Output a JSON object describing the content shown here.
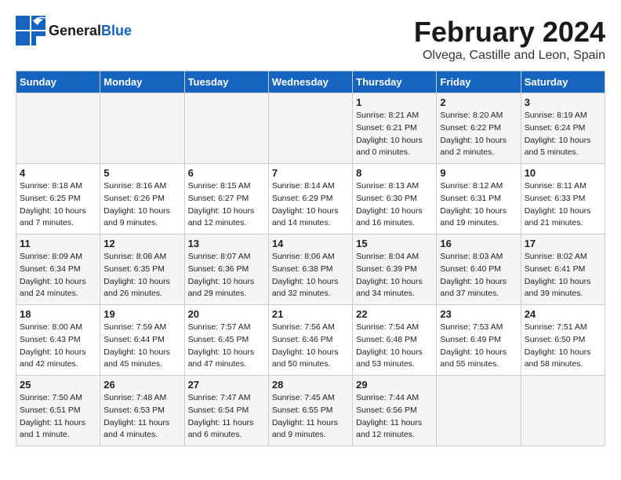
{
  "header": {
    "logo_general": "General",
    "logo_blue": "Blue",
    "month_year": "February 2024",
    "location": "Olvega, Castille and Leon, Spain"
  },
  "days_of_week": [
    "Sunday",
    "Monday",
    "Tuesday",
    "Wednesday",
    "Thursday",
    "Friday",
    "Saturday"
  ],
  "weeks": [
    [
      {
        "day": "",
        "info": ""
      },
      {
        "day": "",
        "info": ""
      },
      {
        "day": "",
        "info": ""
      },
      {
        "day": "",
        "info": ""
      },
      {
        "day": "1",
        "info": "Sunrise: 8:21 AM\nSunset: 6:21 PM\nDaylight: 10 hours\nand 0 minutes."
      },
      {
        "day": "2",
        "info": "Sunrise: 8:20 AM\nSunset: 6:22 PM\nDaylight: 10 hours\nand 2 minutes."
      },
      {
        "day": "3",
        "info": "Sunrise: 8:19 AM\nSunset: 6:24 PM\nDaylight: 10 hours\nand 5 minutes."
      }
    ],
    [
      {
        "day": "4",
        "info": "Sunrise: 8:18 AM\nSunset: 6:25 PM\nDaylight: 10 hours\nand 7 minutes."
      },
      {
        "day": "5",
        "info": "Sunrise: 8:16 AM\nSunset: 6:26 PM\nDaylight: 10 hours\nand 9 minutes."
      },
      {
        "day": "6",
        "info": "Sunrise: 8:15 AM\nSunset: 6:27 PM\nDaylight: 10 hours\nand 12 minutes."
      },
      {
        "day": "7",
        "info": "Sunrise: 8:14 AM\nSunset: 6:29 PM\nDaylight: 10 hours\nand 14 minutes."
      },
      {
        "day": "8",
        "info": "Sunrise: 8:13 AM\nSunset: 6:30 PM\nDaylight: 10 hours\nand 16 minutes."
      },
      {
        "day": "9",
        "info": "Sunrise: 8:12 AM\nSunset: 6:31 PM\nDaylight: 10 hours\nand 19 minutes."
      },
      {
        "day": "10",
        "info": "Sunrise: 8:11 AM\nSunset: 6:33 PM\nDaylight: 10 hours\nand 21 minutes."
      }
    ],
    [
      {
        "day": "11",
        "info": "Sunrise: 8:09 AM\nSunset: 6:34 PM\nDaylight: 10 hours\nand 24 minutes."
      },
      {
        "day": "12",
        "info": "Sunrise: 8:08 AM\nSunset: 6:35 PM\nDaylight: 10 hours\nand 26 minutes."
      },
      {
        "day": "13",
        "info": "Sunrise: 8:07 AM\nSunset: 6:36 PM\nDaylight: 10 hours\nand 29 minutes."
      },
      {
        "day": "14",
        "info": "Sunrise: 8:06 AM\nSunset: 6:38 PM\nDaylight: 10 hours\nand 32 minutes."
      },
      {
        "day": "15",
        "info": "Sunrise: 8:04 AM\nSunset: 6:39 PM\nDaylight: 10 hours\nand 34 minutes."
      },
      {
        "day": "16",
        "info": "Sunrise: 8:03 AM\nSunset: 6:40 PM\nDaylight: 10 hours\nand 37 minutes."
      },
      {
        "day": "17",
        "info": "Sunrise: 8:02 AM\nSunset: 6:41 PM\nDaylight: 10 hours\nand 39 minutes."
      }
    ],
    [
      {
        "day": "18",
        "info": "Sunrise: 8:00 AM\nSunset: 6:43 PM\nDaylight: 10 hours\nand 42 minutes."
      },
      {
        "day": "19",
        "info": "Sunrise: 7:59 AM\nSunset: 6:44 PM\nDaylight: 10 hours\nand 45 minutes."
      },
      {
        "day": "20",
        "info": "Sunrise: 7:57 AM\nSunset: 6:45 PM\nDaylight: 10 hours\nand 47 minutes."
      },
      {
        "day": "21",
        "info": "Sunrise: 7:56 AM\nSunset: 6:46 PM\nDaylight: 10 hours\nand 50 minutes."
      },
      {
        "day": "22",
        "info": "Sunrise: 7:54 AM\nSunset: 6:48 PM\nDaylight: 10 hours\nand 53 minutes."
      },
      {
        "day": "23",
        "info": "Sunrise: 7:53 AM\nSunset: 6:49 PM\nDaylight: 10 hours\nand 55 minutes."
      },
      {
        "day": "24",
        "info": "Sunrise: 7:51 AM\nSunset: 6:50 PM\nDaylight: 10 hours\nand 58 minutes."
      }
    ],
    [
      {
        "day": "25",
        "info": "Sunrise: 7:50 AM\nSunset: 6:51 PM\nDaylight: 11 hours\nand 1 minute."
      },
      {
        "day": "26",
        "info": "Sunrise: 7:48 AM\nSunset: 6:53 PM\nDaylight: 11 hours\nand 4 minutes."
      },
      {
        "day": "27",
        "info": "Sunrise: 7:47 AM\nSunset: 6:54 PM\nDaylight: 11 hours\nand 6 minutes."
      },
      {
        "day": "28",
        "info": "Sunrise: 7:45 AM\nSunset: 6:55 PM\nDaylight: 11 hours\nand 9 minutes."
      },
      {
        "day": "29",
        "info": "Sunrise: 7:44 AM\nSunset: 6:56 PM\nDaylight: 11 hours\nand 12 minutes."
      },
      {
        "day": "",
        "info": ""
      },
      {
        "day": "",
        "info": ""
      }
    ]
  ]
}
